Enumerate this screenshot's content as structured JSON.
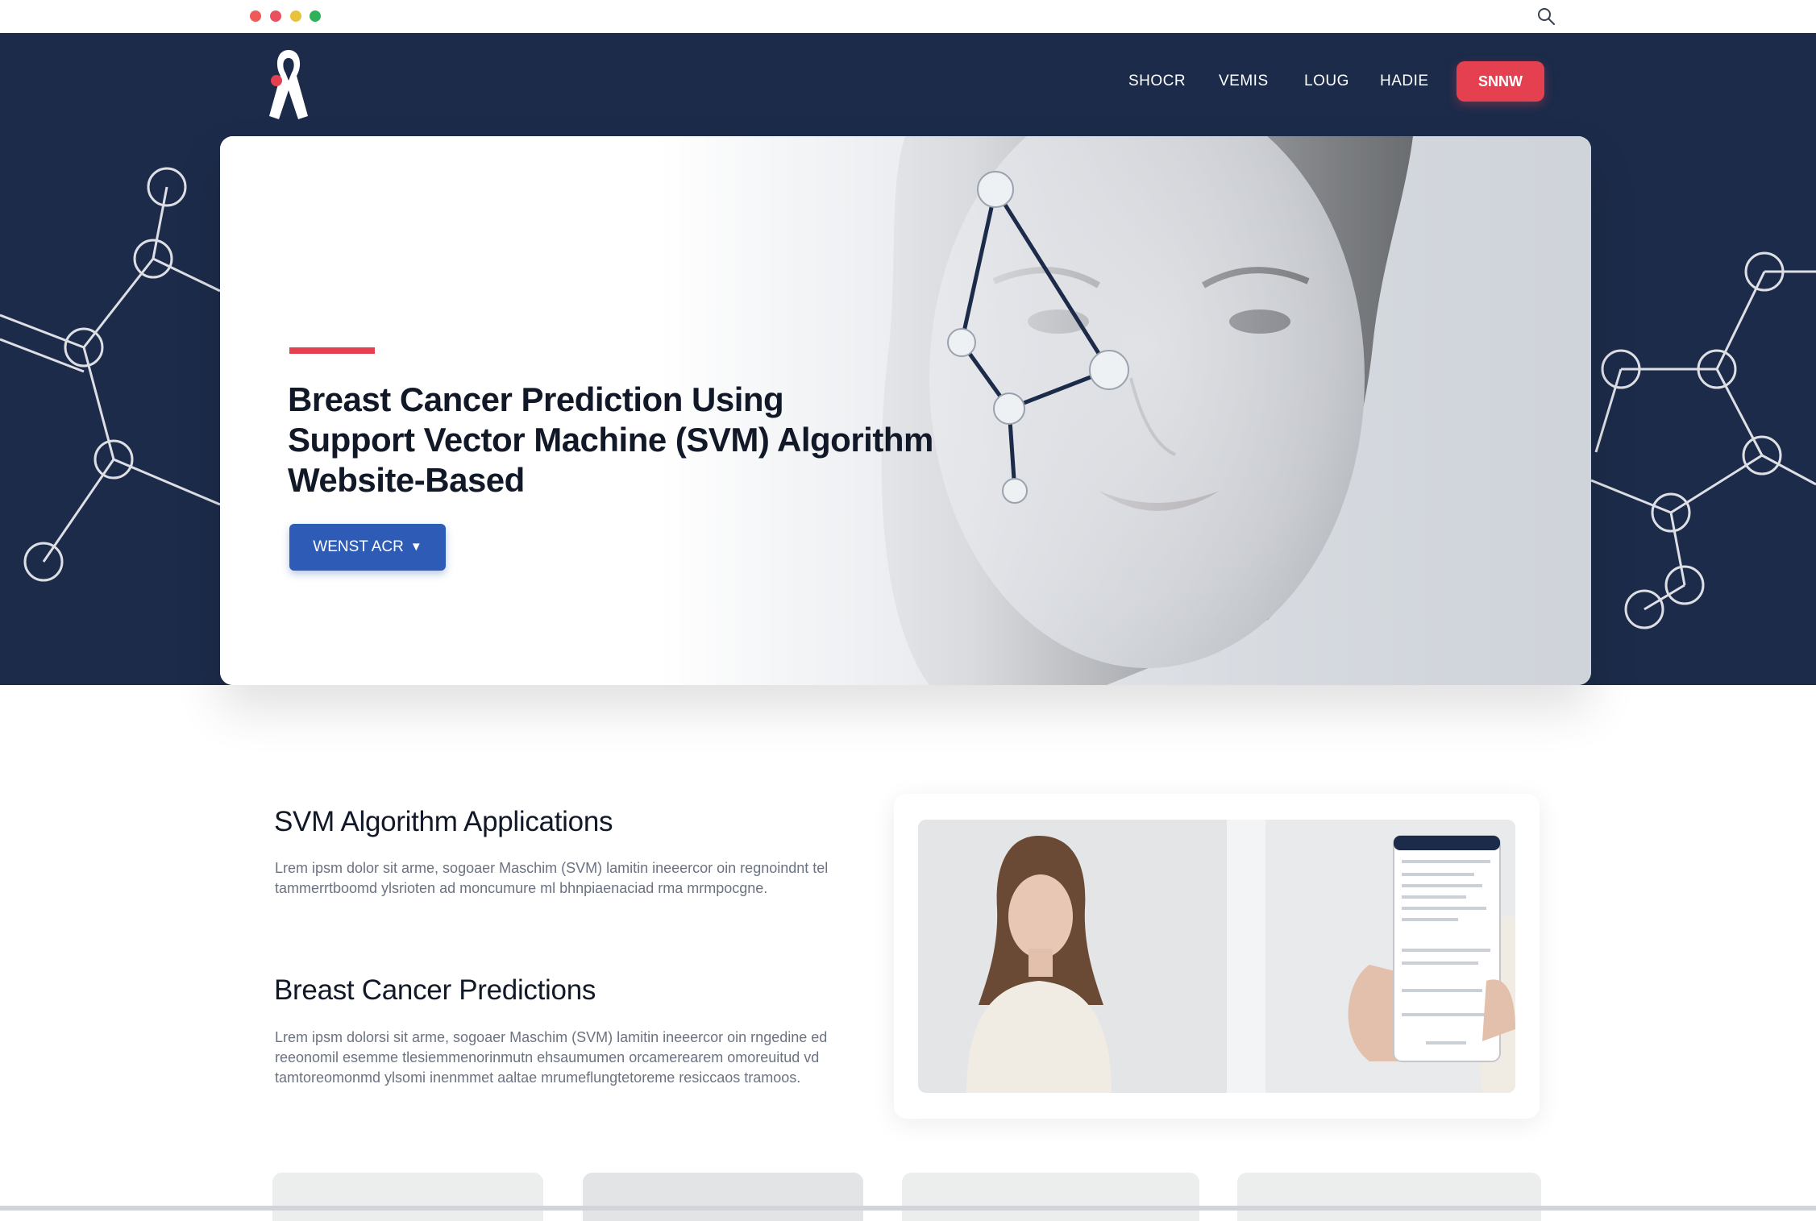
{
  "window": {
    "dots": [
      {
        "color": "#ee5a5a"
      },
      {
        "color": "#e8515e"
      },
      {
        "color": "#e9c23c"
      },
      {
        "color": "#2fb15a"
      }
    ],
    "search_icon": "search-icon"
  },
  "brand": {
    "logo_icon": "awareness-ribbon-icon",
    "navy": "#1c2b4a",
    "accent_red": "#e5404f",
    "accent_blue": "#2d5bb5"
  },
  "nav": {
    "links": [
      "SHOCR",
      "VEMIS",
      "LOUG",
      "HADIE"
    ],
    "cta": "SNNW"
  },
  "hero": {
    "title_lines": [
      "Breast Cancer Prediction Using",
      "Support Vector Machine (SVM) Algorithm",
      "Website-Based"
    ],
    "button_label": "WENST ACR",
    "button_icon": "chevron-down-icon"
  },
  "sections": [
    {
      "heading": "SVM Algorithm Applications",
      "body": "Lrem ipsm dolor sit arme, sogoaer Maschim (SVM) lamitin ineeercor oin regnoindnt tel tammerrtboomd ylsrioten ad moncumure ml bhnpiaenaciad rma mrmpocgne."
    },
    {
      "heading": "Breast Cancer Predictions",
      "body": "Lrem ipsm dolorsi sit arme, sogoaer Maschim (SVM) lamitin ineeercor oin rngedine ed reeonomil esemme tlesiemmenorinmutn ehsaumumen orcamerearem omoreuitud vd tamtoreomonmd ylsomi inenmmet aaltae mrumeflungtetoreme resiccaos tramoos."
    }
  ]
}
